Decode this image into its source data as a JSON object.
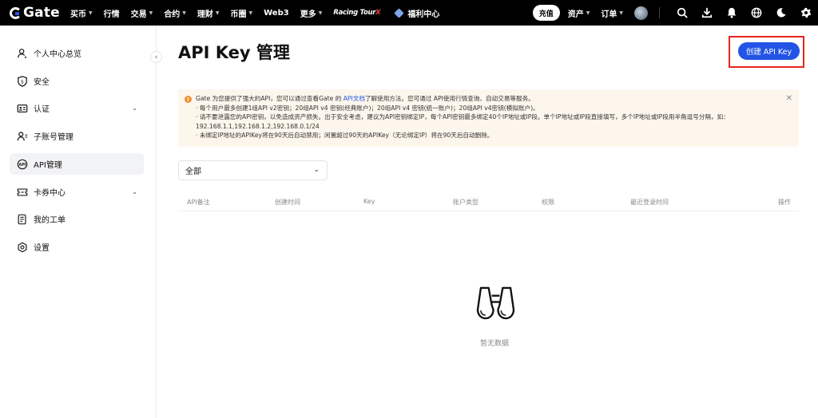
{
  "nav": {
    "logo": "Gate",
    "items": [
      {
        "label": "买币",
        "caret": true
      },
      {
        "label": "行情",
        "caret": false
      },
      {
        "label": "交易",
        "caret": true
      },
      {
        "label": "合约",
        "caret": true
      },
      {
        "label": "理财",
        "caret": true
      },
      {
        "label": "币圈",
        "caret": true
      },
      {
        "label": "Web3",
        "caret": false
      },
      {
        "label": "更多",
        "caret": true
      }
    ],
    "racing_tour": "Racing Tour",
    "racing_tour_suffix": "X",
    "welfare_center": "福利中心",
    "deposit": "充值",
    "assets": "资产",
    "orders": "订单"
  },
  "sidebar": {
    "items": [
      {
        "label": "个人中心总览",
        "icon": "user-icon",
        "chevron": false
      },
      {
        "label": "安全",
        "icon": "shield-icon",
        "chevron": false
      },
      {
        "label": "认证",
        "icon": "id-card-icon",
        "chevron": true
      },
      {
        "label": "子账号管理",
        "icon": "sub-account-icon",
        "chevron": false
      },
      {
        "label": "API管理",
        "icon": "api-icon",
        "chevron": false,
        "active": true
      },
      {
        "label": "卡券中心",
        "icon": "coupon-icon",
        "chevron": true
      },
      {
        "label": "我的工单",
        "icon": "ticket-icon",
        "chevron": false
      },
      {
        "label": "设置",
        "icon": "settings-icon",
        "chevron": false
      }
    ]
  },
  "main": {
    "title": "API Key 管理",
    "create_button": "创建 API Key",
    "notice": {
      "line1_prefix": "Gate 为您提供了强大的API，您可以通过查看Gate 的 ",
      "line1_link": "API文档",
      "line1_suffix": "了解使用方法。您可通过 API使用行情查询、自动交易等服务。",
      "line2": "· 每个用户最多创建1组API v2密钥；20组API v4 密钥(经典账户)；20组API v4 密钥(统一账户)；20组API v4密钥(模拟账户)。",
      "line3": "· 请不要泄露您的API密钥，以免造成资产损失。出于安全考虑，建议为API密钥绑定IP，每个API密钥最多绑定40个IP地址或IP段。单个IP地址或IP段直接填写，多个IP地址或IP段用半角逗号分隔，如：",
      "line4": "192.168.1.1,192.168.1.2,192.168.0.1/24",
      "line5": "· 未绑定IP地址的APIKey将在90天后自动禁用；闲置超过90天的APIKey（无论绑定IP）将在90天后自动删除。"
    },
    "filter_value": "全部",
    "table_headers": [
      "API备注",
      "创建时间",
      "Key",
      "账户类型",
      "权限",
      "最近登录时间",
      "操作"
    ],
    "empty_text": "暂无数据"
  },
  "colors": {
    "accent": "#2354e6",
    "highlight": "#e8251c",
    "notice_bg": "#fdf6ec",
    "notice_icon": "#ef8f2f"
  }
}
